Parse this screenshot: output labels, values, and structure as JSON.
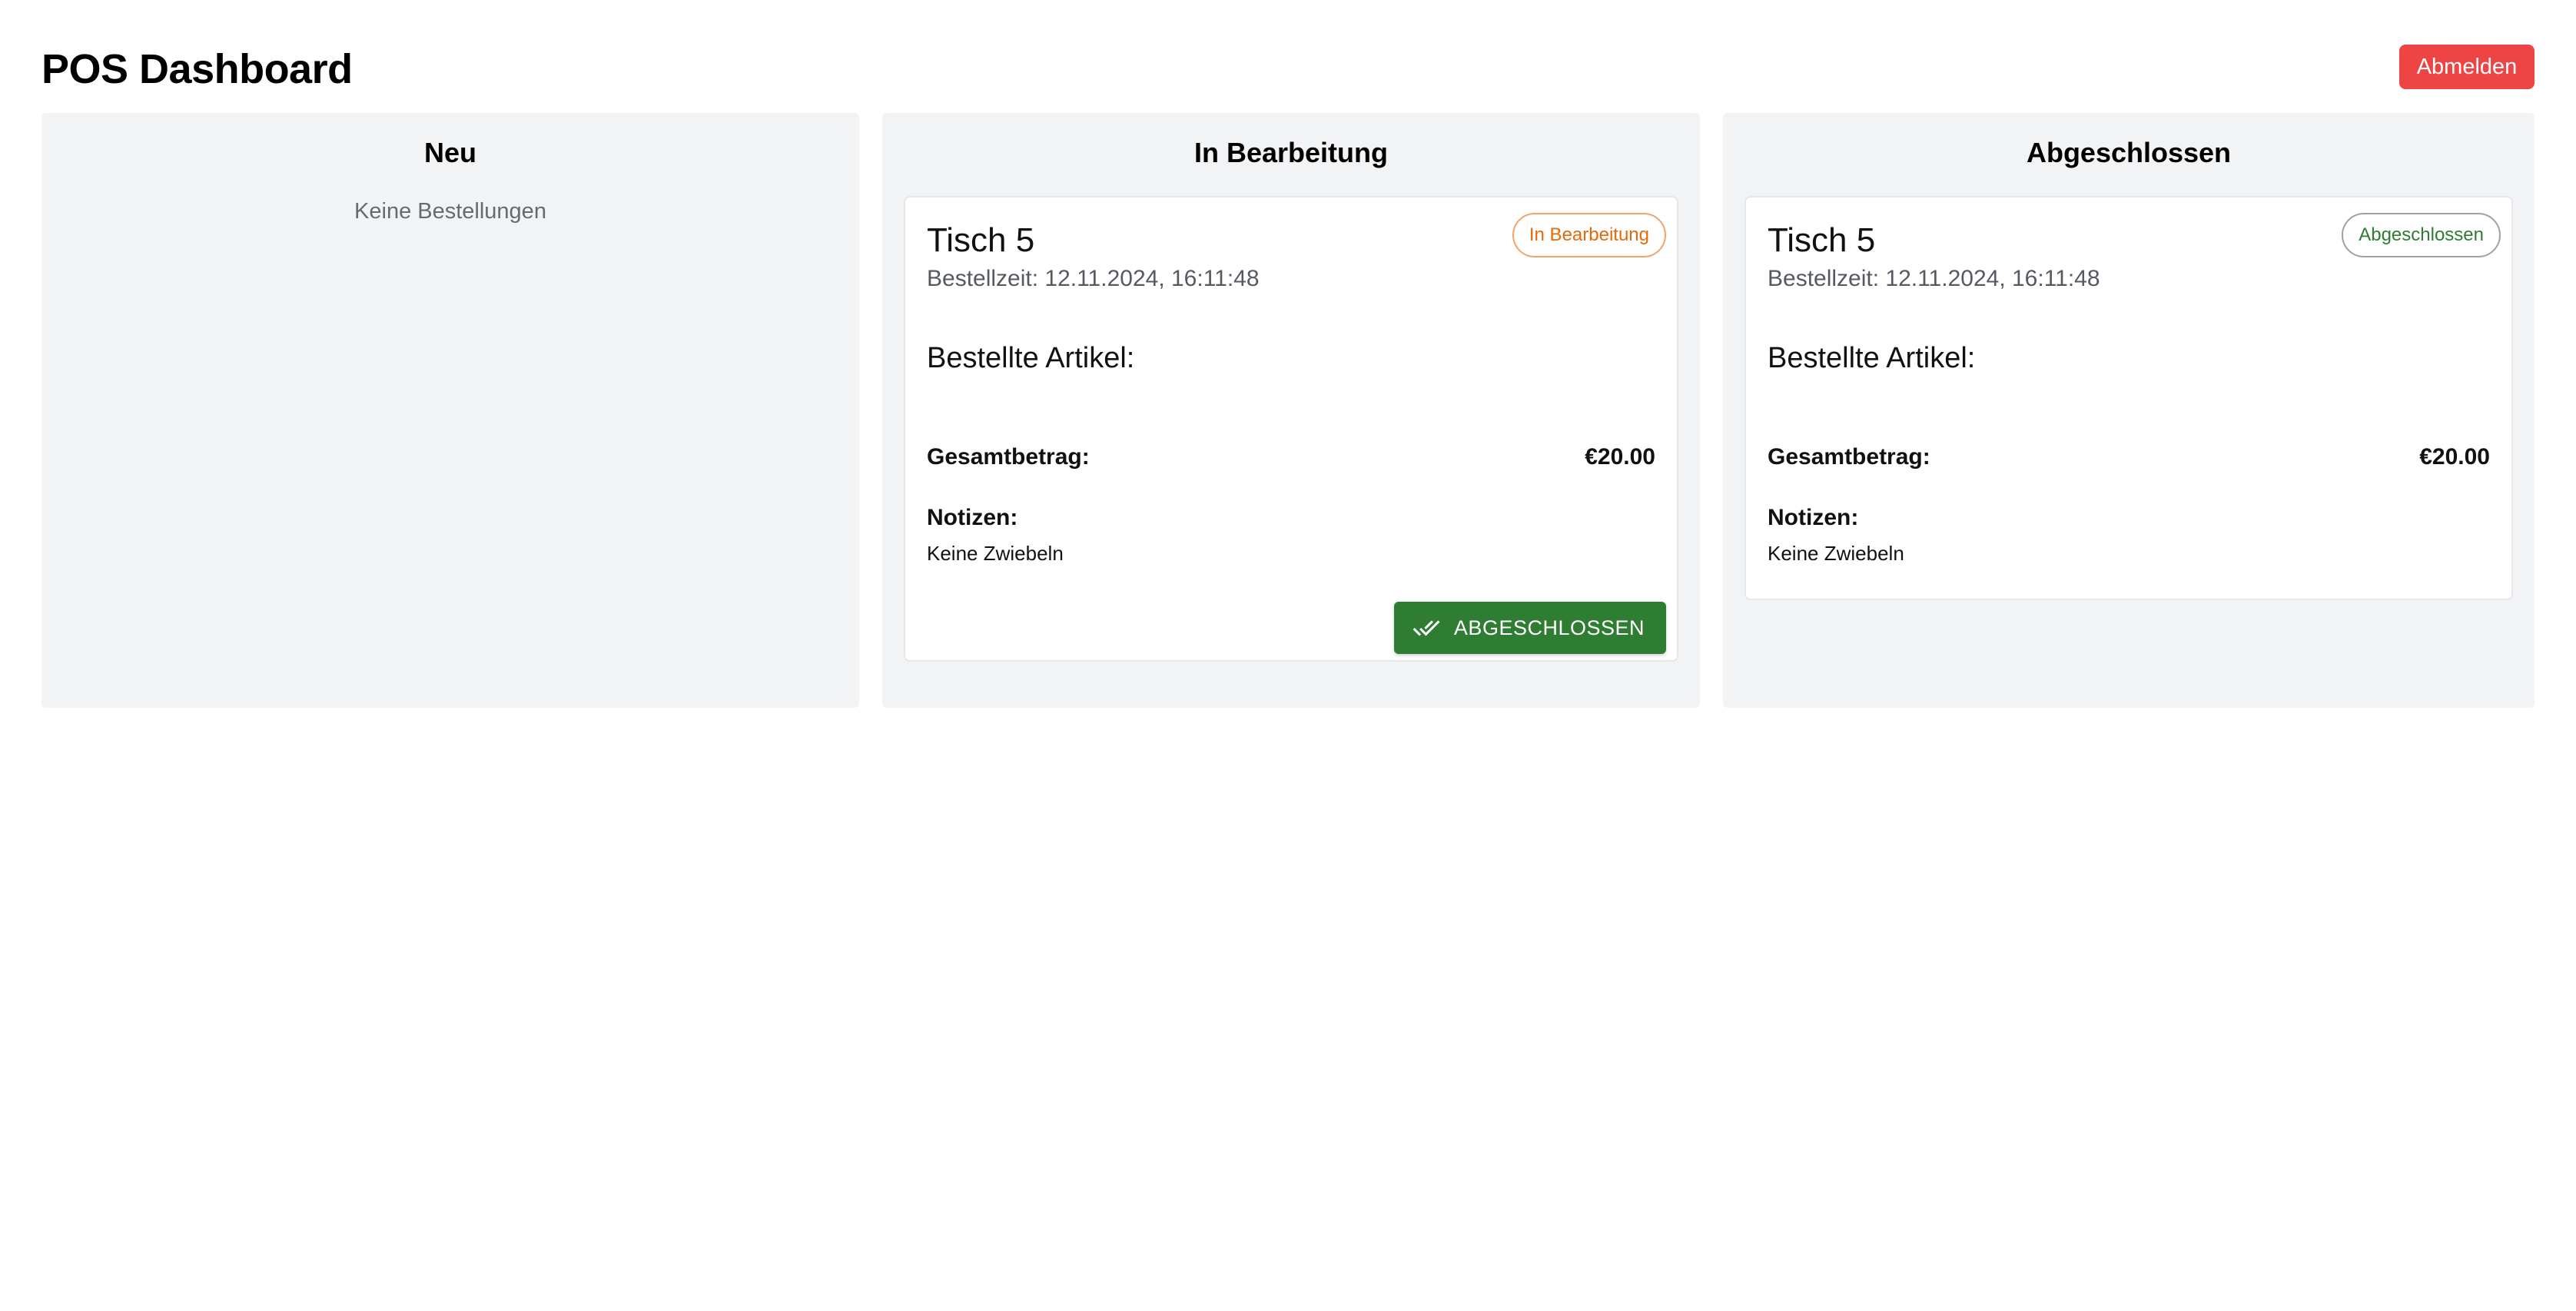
{
  "header": {
    "title": "POS Dashboard",
    "logout_label": "Abmelden"
  },
  "columns": [
    {
      "title": "Neu",
      "empty_text": "Keine Bestellungen"
    },
    {
      "title": "In Bearbeitung",
      "order": {
        "table": "Tisch 5",
        "order_time": "Bestellzeit: 12.11.2024, 16:11:48",
        "status": "In Bearbeitung",
        "items_heading": "Bestellte Artikel:",
        "total_label": "Gesamtbetrag:",
        "total_value": "€20.00",
        "notes_label": "Notizen:",
        "notes_text": "Keine Zwiebeln",
        "action_label": "ABGESCHLOSSEN",
        "action_icon": "done-all-icon"
      }
    },
    {
      "title": "Abgeschlossen",
      "order": {
        "table": "Tisch 5",
        "order_time": "Bestellzeit: 12.11.2024, 16:11:48",
        "status": "Abgeschlossen",
        "items_heading": "Bestellte Artikel:",
        "total_label": "Gesamtbetrag:",
        "total_value": "€20.00",
        "notes_label": "Notizen:",
        "notes_text": "Keine Zwiebeln"
      }
    }
  ],
  "colors": {
    "logout": "#ef4444",
    "column_bg": "#f2f3f5",
    "status_processing": "#e66a0a",
    "status_done": "#2e7d32",
    "action_button": "#2e7d32"
  }
}
